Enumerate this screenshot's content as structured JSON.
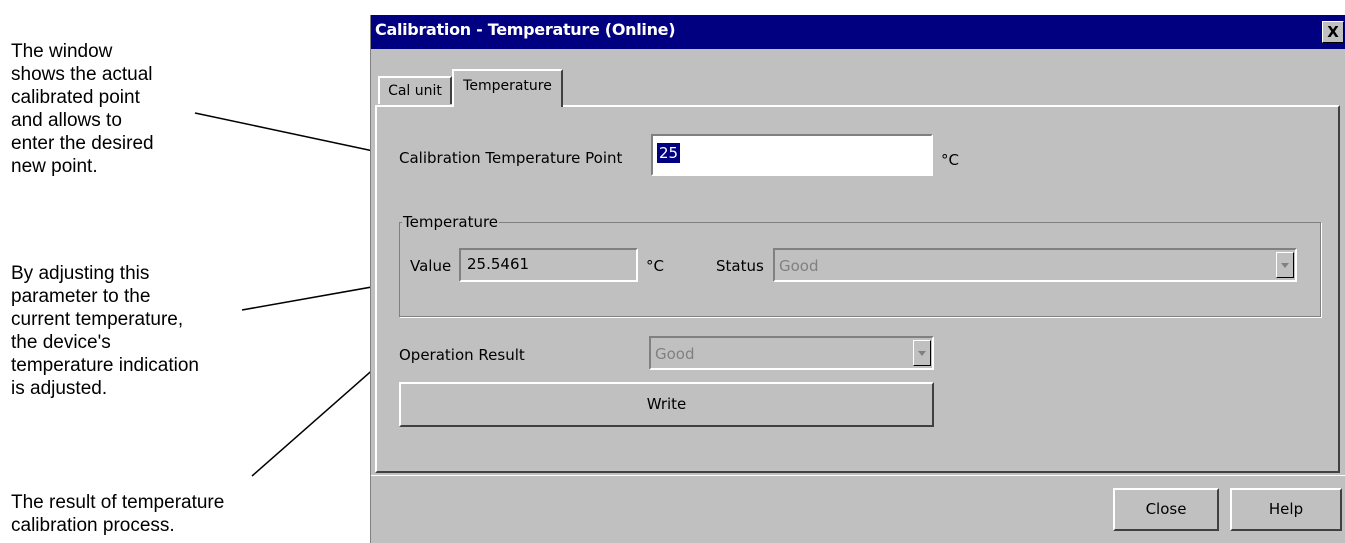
{
  "annotations": {
    "window_note": [
      "The window",
      "shows the actual",
      "calibrated point",
      "and allows to",
      "enter the desired",
      "new point."
    ],
    "adjust_note": [
      "By adjusting this",
      "parameter to the",
      "current temperature,",
      "the device's",
      "temperature indication",
      "is adjusted."
    ],
    "result_note": [
      "The result of temperature",
      "calibration process."
    ]
  },
  "dialog": {
    "title": "Calibration - Temperature  (Online)",
    "close_glyph": "X",
    "tabs": [
      {
        "label": "Cal unit",
        "active": false
      },
      {
        "label": "Temperature",
        "active": true
      }
    ],
    "cal_point": {
      "label": "Calibration Temperature Point",
      "value": "25",
      "unit": "°C"
    },
    "temperature_group": {
      "legend": "Temperature",
      "value_label": "Value",
      "value": "25.5461",
      "unit": "°C",
      "status_label": "Status",
      "status_value": "Good"
    },
    "operation_result": {
      "label": "Operation Result",
      "value": "Good"
    },
    "write_label": "Write",
    "close_label": "Close",
    "help_label": "Help"
  }
}
